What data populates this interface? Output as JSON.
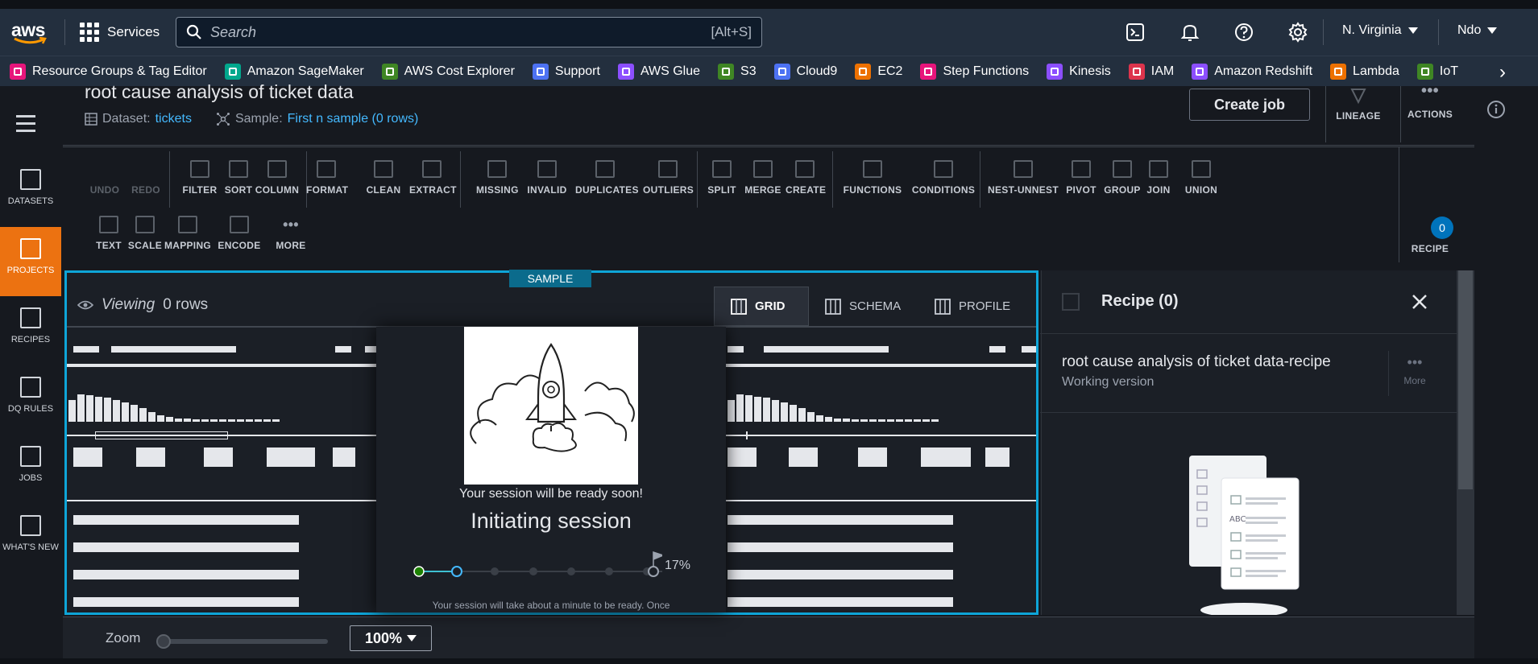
{
  "topnav": {
    "services_label": "Services",
    "search_placeholder": "Search",
    "search_shortcut": "[Alt+S]",
    "region": "N. Virginia",
    "user": "Ndo"
  },
  "favorites": [
    {
      "label": "Resource Groups & Tag Editor",
      "color": "#e7157b"
    },
    {
      "label": "Amazon SageMaker",
      "color": "#01a88d"
    },
    {
      "label": "AWS Cost Explorer",
      "color": "#3f8624"
    },
    {
      "label": "Support",
      "color": "#4d72f3"
    },
    {
      "label": "AWS Glue",
      "color": "#8c4fff"
    },
    {
      "label": "S3",
      "color": "#3f8624"
    },
    {
      "label": "Cloud9",
      "color": "#4d72f3"
    },
    {
      "label": "EC2",
      "color": "#ed7100"
    },
    {
      "label": "Step Functions",
      "color": "#e7157b"
    },
    {
      "label": "Kinesis",
      "color": "#8c4fff"
    },
    {
      "label": "IAM",
      "color": "#dd344c"
    },
    {
      "label": "Amazon Redshift",
      "color": "#8c4fff"
    },
    {
      "label": "Lambda",
      "color": "#ed7100"
    },
    {
      "label": "IoT",
      "color": "#3f8624"
    }
  ],
  "rail": [
    {
      "label": "DATASETS",
      "active": false
    },
    {
      "label": "PROJECTS",
      "active": true
    },
    {
      "label": "RECIPES",
      "active": false
    },
    {
      "label": "DQ RULES",
      "active": false
    },
    {
      "label": "JOBS",
      "active": false
    },
    {
      "label": "WHAT'S NEW",
      "active": false
    }
  ],
  "header": {
    "title": "root cause analysis of ticket data",
    "dataset_label": "Dataset:",
    "dataset_value": "tickets",
    "sample_label": "Sample:",
    "sample_value": "First n sample (0 rows)",
    "create_job": "Create job",
    "lineage": "LINEAGE",
    "actions": "ACTIONS"
  },
  "toolbar": {
    "row1": [
      {
        "label": "UNDO",
        "dim": true
      },
      {
        "label": "REDO",
        "dim": true
      },
      {
        "label": "FILTER"
      },
      {
        "label": "SORT"
      },
      {
        "label": "COLUMN"
      },
      {
        "label": "FORMAT"
      },
      {
        "label": "CLEAN"
      },
      {
        "label": "EXTRACT"
      },
      {
        "label": "MISSING"
      },
      {
        "label": "INVALID"
      },
      {
        "label": "DUPLICATES"
      },
      {
        "label": "OUTLIERS"
      },
      {
        "label": "SPLIT"
      },
      {
        "label": "MERGE"
      },
      {
        "label": "CREATE"
      },
      {
        "label": "FUNCTIONS"
      },
      {
        "label": "CONDITIONS"
      },
      {
        "label": "NEST-UNNEST"
      },
      {
        "label": "PIVOT"
      },
      {
        "label": "GROUP"
      },
      {
        "label": "JOIN"
      },
      {
        "label": "UNION"
      }
    ],
    "row2": [
      {
        "label": "TEXT"
      },
      {
        "label": "SCALE"
      },
      {
        "label": "MAPPING"
      },
      {
        "label": "ENCODE"
      },
      {
        "label": "MORE"
      }
    ],
    "recipe_label": "RECIPE",
    "recipe_count": "0"
  },
  "grid": {
    "sample_badge": "SAMPLE",
    "viewing_label": "Viewing",
    "rows_label": "0 rows",
    "tabs": [
      {
        "label": "GRID",
        "active": true
      },
      {
        "label": "SCHEMA",
        "active": false
      },
      {
        "label": "PROFILE",
        "active": false
      }
    ]
  },
  "session": {
    "ready_text": "Your session will be ready soon!",
    "status": "Initiating session",
    "progress_percent": 17,
    "progress_label": "17%",
    "note": "Your session will take about a minute to be ready. Once"
  },
  "recipe_panel": {
    "title": "Recipe (0)",
    "recipe_name": "root cause analysis of ticket data-recipe",
    "version": "Working version",
    "more": "More"
  },
  "zoom": {
    "label": "Zoom",
    "value": "100%"
  }
}
